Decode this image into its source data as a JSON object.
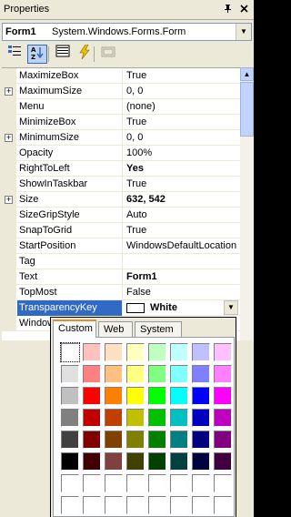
{
  "window": {
    "title": "Properties",
    "pin_icon": "pin-icon",
    "close_icon": "close-icon"
  },
  "object_selector": {
    "name": "Form1",
    "type": "System.Windows.Forms.Form"
  },
  "toolbar": {
    "buttons": [
      "categorized-icon",
      "alphabetical-icon",
      "properties-icon",
      "events-icon",
      "property-pages-icon"
    ]
  },
  "properties": [
    {
      "name": "MaximizeBox",
      "value": "True",
      "expandable": false,
      "bold": false
    },
    {
      "name": "MaximumSize",
      "value": "0, 0",
      "expandable": true,
      "bold": false
    },
    {
      "name": "Menu",
      "value": "(none)",
      "expandable": false,
      "bold": false
    },
    {
      "name": "MinimizeBox",
      "value": "True",
      "expandable": false,
      "bold": false
    },
    {
      "name": "MinimumSize",
      "value": "0, 0",
      "expandable": true,
      "bold": false
    },
    {
      "name": "Opacity",
      "value": "100%",
      "expandable": false,
      "bold": false
    },
    {
      "name": "RightToLeft",
      "value": "Yes",
      "expandable": false,
      "bold": true
    },
    {
      "name": "ShowInTaskbar",
      "value": "True",
      "expandable": false,
      "bold": false
    },
    {
      "name": "Size",
      "value": "632, 542",
      "expandable": true,
      "bold": true
    },
    {
      "name": "SizeGripStyle",
      "value": "Auto",
      "expandable": false,
      "bold": false
    },
    {
      "name": "SnapToGrid",
      "value": "True",
      "expandable": false,
      "bold": false
    },
    {
      "name": "StartPosition",
      "value": "WindowsDefaultLocation",
      "expandable": false,
      "bold": false
    },
    {
      "name": "Tag",
      "value": "",
      "expandable": false,
      "bold": false
    },
    {
      "name": "Text",
      "value": "Form1",
      "expandable": false,
      "bold": true
    },
    {
      "name": "TopMost",
      "value": "False",
      "expandable": false,
      "bold": false
    },
    {
      "name": "TransparencyKey",
      "value": "White",
      "expandable": false,
      "bold": false,
      "selected": true
    },
    {
      "name": "WindowState",
      "value": "",
      "expandable": false,
      "bold": false
    }
  ],
  "color_picker": {
    "tabs": [
      "Custom",
      "Web",
      "System"
    ],
    "active_tab": "Custom",
    "selected_color": "#ffffff",
    "colors": [
      [
        "#ffffff",
        "#ffc0c0",
        "#ffe0c0",
        "#ffffc0",
        "#c0ffc0",
        "#c0ffff",
        "#c0c0ff",
        "#ffc0ff"
      ],
      [
        "#e0e0e0",
        "#ff8080",
        "#ffc080",
        "#ffff80",
        "#80ff80",
        "#80ffff",
        "#8080ff",
        "#ff80ff"
      ],
      [
        "#c0c0c0",
        "#ff0000",
        "#ff8000",
        "#ffff00",
        "#00ff00",
        "#00ffff",
        "#0000ff",
        "#ff00ff"
      ],
      [
        "#808080",
        "#c00000",
        "#c04000",
        "#c0c000",
        "#00c000",
        "#00c0c0",
        "#0000c0",
        "#c000c0"
      ],
      [
        "#404040",
        "#800000",
        "#804000",
        "#808000",
        "#008000",
        "#008080",
        "#000080",
        "#800080"
      ],
      [
        "#000000",
        "#400000",
        "#804040",
        "#404000",
        "#004000",
        "#004040",
        "#000040",
        "#400040"
      ],
      [
        "#ffffff",
        "#ffffff",
        "#ffffff",
        "#ffffff",
        "#ffffff",
        "#ffffff",
        "#ffffff",
        "#ffffff"
      ],
      [
        "#ffffff",
        "#ffffff",
        "#ffffff",
        "#ffffff",
        "#ffffff",
        "#ffffff",
        "#ffffff",
        "#ffffff"
      ]
    ]
  }
}
